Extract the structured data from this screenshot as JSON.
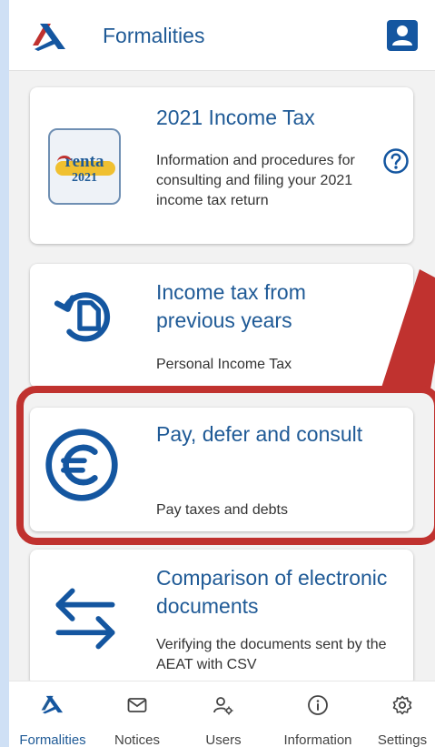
{
  "appbar": {
    "title": "Formalities",
    "logo_icon": "aeat-logo-icon",
    "profile_icon": "profile-icon"
  },
  "cards": [
    {
      "title": "2021 Income Tax",
      "description": "Information and procedures for consulting and filing your 2021 income tax return",
      "icon": "renta-2021-icon",
      "icon_text_1": "renta",
      "icon_text_2": "2021",
      "help_icon": "help-circle-icon"
    },
    {
      "title": "Income tax from previous years",
      "description": "Personal Income Tax",
      "icon": "history-document-icon"
    },
    {
      "title": "Pay, defer and consult",
      "description": "Pay taxes and debts",
      "icon": "euro-icon"
    },
    {
      "title": "Comparison of electronic documents",
      "description": "Verifying the documents sent by the AEAT with CSV",
      "icon": "swap-arrows-icon"
    }
  ],
  "bottom_nav": [
    {
      "label": "Formalities",
      "icon": "aeat-logo-icon",
      "active": true
    },
    {
      "label": "Notices",
      "icon": "mail-icon",
      "active": false
    },
    {
      "label": "Users",
      "icon": "user-settings-icon",
      "active": false
    },
    {
      "label": "Information",
      "icon": "info-icon",
      "active": false
    },
    {
      "label": "Settings",
      "icon": "gear-icon",
      "active": false
    }
  ],
  "colors": {
    "brand_blue": "#1f5a96",
    "accent_blue": "#1456a0",
    "annotation_red": "#c0322f"
  }
}
